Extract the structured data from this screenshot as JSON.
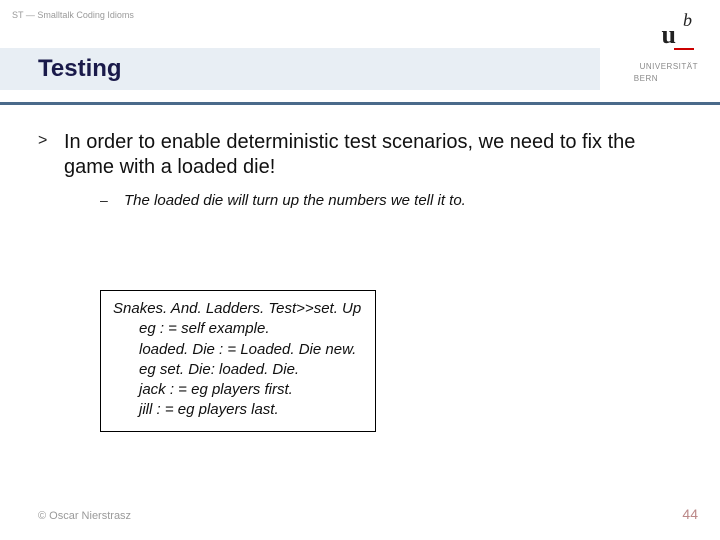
{
  "header": {
    "course_label": "ST — Smalltalk Coding Idioms"
  },
  "logo": {
    "b": "b",
    "u": "u",
    "line1": "UNIVERSITÄT",
    "line2": "BERN"
  },
  "title": "Testing",
  "main_bullet": {
    "marker": ">",
    "text": "In order to enable deterministic test scenarios, we need to fix the game with a loaded die!"
  },
  "sub_bullet": {
    "marker": "–",
    "text": "The loaded die will turn up the numbers we tell it to."
  },
  "code": {
    "line0": "Snakes. And. Ladders. Test>>set. Up",
    "line1": "eg : = self example.",
    "line2": "loaded. Die : = Loaded. Die new.",
    "line3": "eg set. Die: loaded. Die.",
    "line4": "jack : = eg players first.",
    "line5": "jill : = eg players last."
  },
  "footer": {
    "copyright": "© Oscar Nierstrasz",
    "page": "44"
  }
}
